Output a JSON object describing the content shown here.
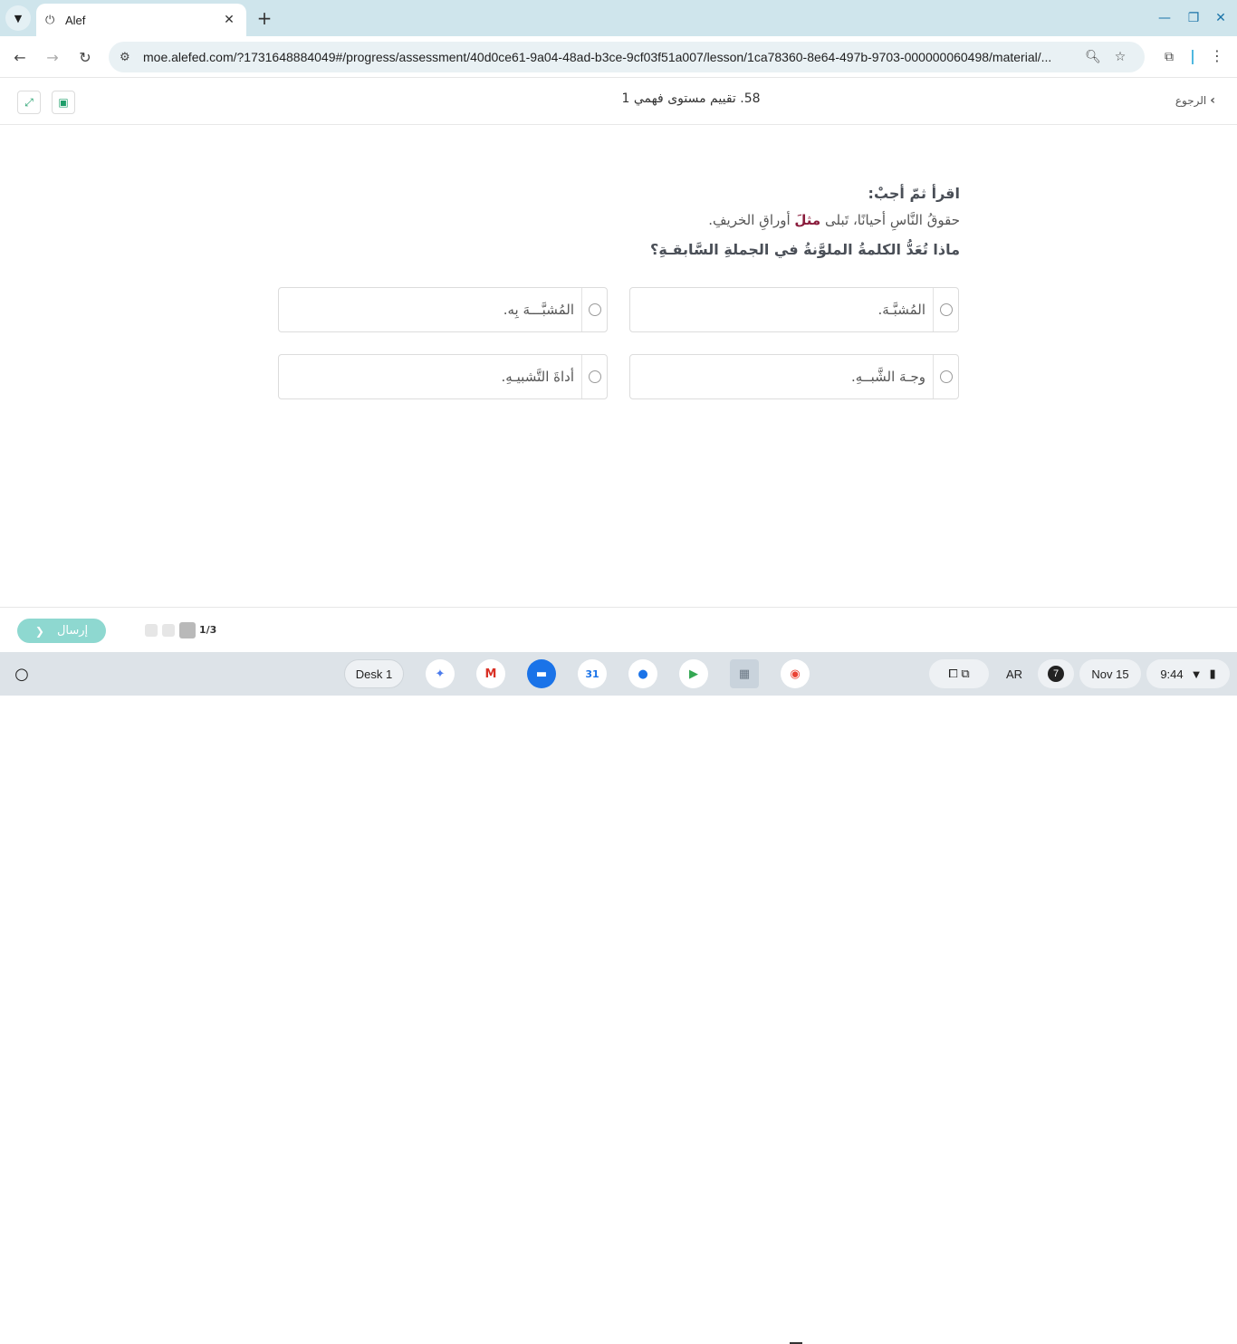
{
  "browser": {
    "tab_title": "Alef",
    "url_host": "moe.alefed.com",
    "url_path": "/?1731648884049#/progress/assessment/40d0ce61-9a04-48ad-b3ce-9cf03f51a007/lesson/1ca78360-8e64-497b-9703-000000060498/material/..."
  },
  "header": {
    "title": "58. تقييم مستوى فهمي 1",
    "back_label": "الرجوع"
  },
  "question": {
    "instruction": "اقرأ ثمّ أجبْ:",
    "sentence_before": "حقوقُ النَّاسِ أحيانًا، تَبلى ",
    "sentence_highlight": "مثلَ",
    "sentence_after": " أوراقِ الخريفِ.",
    "ask": "ماذا تُعَدُّ الكلمةُ الملوَّنةُ في الجملةِ السَّابقـةِ؟"
  },
  "options": [
    {
      "label": "المُشبَّـهَ."
    },
    {
      "label": "المُشبَّـــهَ بِه."
    },
    {
      "label": "وجـهَ الشَّبــهِ."
    },
    {
      "label": "أداةَ التَّشبيـهِ."
    }
  ],
  "footer": {
    "submit_label": "إرسال",
    "page_count": "1/3"
  },
  "shelf": {
    "desk_label": "Desk 1",
    "lang": "AR",
    "notif_count": "7",
    "date": "Nov 15",
    "time": "9:44"
  },
  "colors": {
    "accent": "#8ed8d0",
    "highlight": "#8a1c3c",
    "omnibox_bg": "#e9f1f4",
    "tabstrip_bg": "#cfe5ec"
  }
}
